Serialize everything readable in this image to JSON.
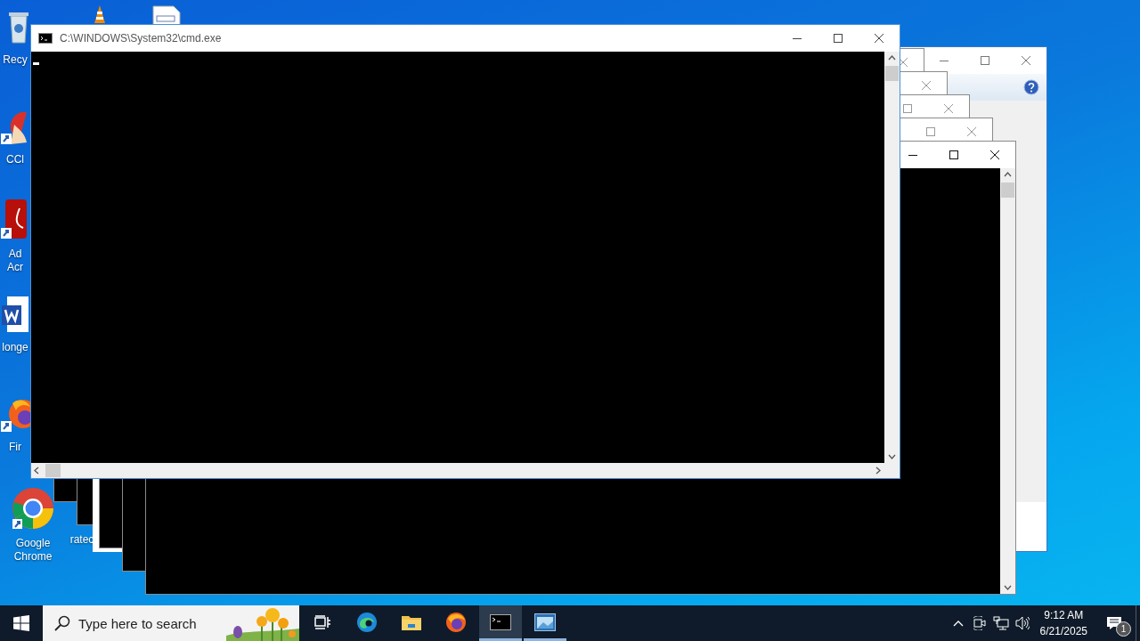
{
  "desktop": {
    "icons": [
      {
        "label": "Recy"
      },
      {
        "label": "CCl"
      },
      {
        "label": "Ad Acr"
      },
      {
        "label": "longe"
      },
      {
        "label": "Fir"
      },
      {
        "label": "Google Chrome"
      },
      {
        "label": "ratec"
      }
    ]
  },
  "window": {
    "title": "C:\\WINDOWS\\System32\\cmd.exe",
    "active": true
  },
  "taskbar": {
    "search": {
      "placeholder": "Type here to search"
    },
    "apps": [
      {
        "selected": false,
        "running": false
      },
      {
        "selected": false,
        "running": false
      },
      {
        "selected": false,
        "running": false
      },
      {
        "selected": false,
        "running": false
      },
      {
        "selected": true,
        "running": true
      },
      {
        "selected": false,
        "running": true
      }
    ],
    "clock": {
      "time": "9:12 AM",
      "date": "6/21/2025"
    },
    "notifications": {
      "badge": "1"
    }
  }
}
